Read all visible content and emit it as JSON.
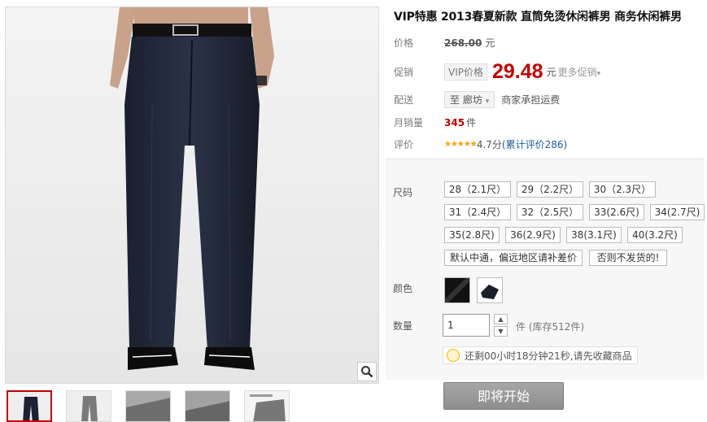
{
  "product": {
    "title": "VIP特惠 2013春夏新款 直筒免烫休闲裤男 商务休闲裤男"
  },
  "price": {
    "label": "价格",
    "original": "268.00",
    "currency_unit": "元"
  },
  "promo": {
    "label": "促销",
    "vip_tag": "VIP价格",
    "price": "29.48",
    "currency_unit": "元",
    "more_link": "更多促销",
    "more_arrow": "▾"
  },
  "shipping": {
    "label": "配送",
    "prefix": "至",
    "destination": "廊坊",
    "dropdown_arrow": "▾",
    "note": "商家承担运费"
  },
  "sales": {
    "label": "月销量",
    "count": "345",
    "unit": "件"
  },
  "rating": {
    "label": "评价",
    "stars_glyph": "★★★★★",
    "score_text": "4.7分",
    "reviews_open": "(",
    "reviews_link": "累计评价286",
    "reviews_close": ")",
    "rating_value": 4.7
  },
  "options": {
    "size_label": "尺码",
    "sizes": [
      "28（2.1尺）",
      "29（2.2尺）",
      "30（2.3尺）",
      "31（2.4尺）",
      "32（2.5尺）",
      "33(2.6尺)",
      "34(2.7尺)",
      "35(2.8尺)",
      "36(2.9尺)",
      "38(3.1尺)",
      "40(3.2尺)",
      "默认中通，偏远地区请补差价",
      "否则不发货的!"
    ],
    "color_label": "颜色",
    "quantity_label": "数量",
    "quantity_value": "1",
    "stock_text": "件 (库存512件)",
    "timer_notice": "还剩00小时18分钟21秒,请先收藏商品",
    "start_button": "即将开始"
  },
  "icons": {
    "zoom": "magnifier-icon",
    "bulb": "lightbulb-icon",
    "step_up": "▲",
    "step_down": "▼"
  },
  "colors": {
    "accent": "#c40000",
    "link": "#1d5aa8",
    "star": "#f7a400",
    "button": "#999999"
  }
}
